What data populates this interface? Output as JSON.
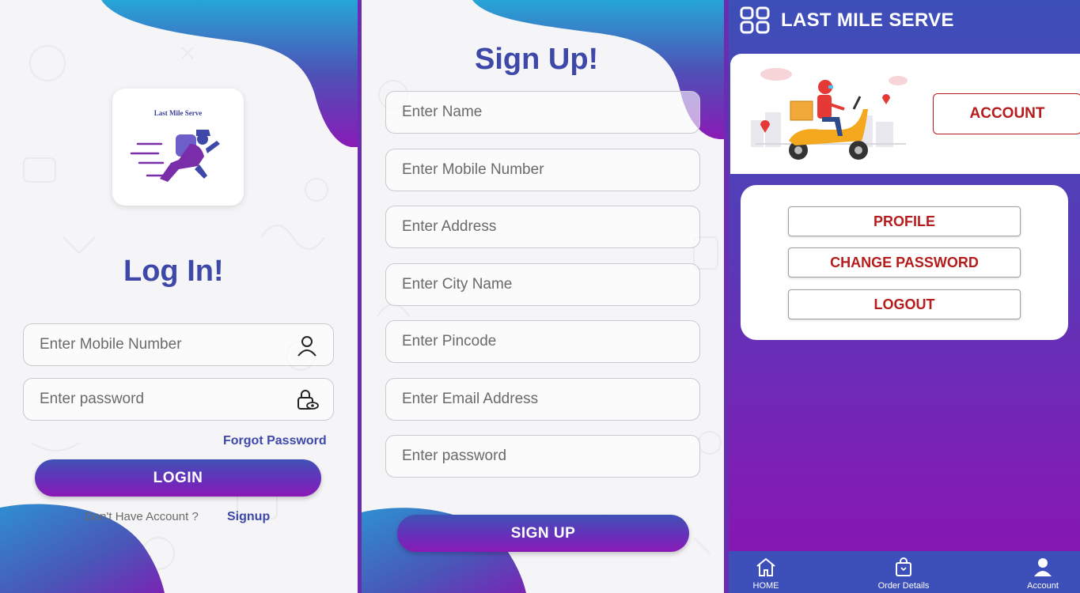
{
  "login": {
    "logo_text": "Last Mile Serve",
    "title": "Log In!",
    "mobile_placeholder": "Enter Mobile Number",
    "password_placeholder": "Enter password",
    "forgot_label": "Forgot Password",
    "login_label": "LOGIN",
    "no_account_text": "Don't Have Account ?",
    "signup_link": "Signup"
  },
  "signup": {
    "title": "Sign Up!",
    "fields": [
      {
        "placeholder": "Enter Name"
      },
      {
        "placeholder": "Enter Mobile Number"
      },
      {
        "placeholder": "Enter Address"
      },
      {
        "placeholder": "Enter City Name"
      },
      {
        "placeholder": "Enter Pincode"
      },
      {
        "placeholder": "Enter Email Address"
      },
      {
        "placeholder": "Enter password"
      }
    ],
    "signup_label": "SIGN UP"
  },
  "account": {
    "app_title": "LAST MILE SERVE",
    "banner_label": "ACCOUNT",
    "menu": [
      {
        "label": "PROFILE"
      },
      {
        "label": "CHANGE PASSWORD"
      },
      {
        "label": "LOGOUT"
      }
    ],
    "nav": [
      {
        "label": "HOME",
        "icon": "home-icon"
      },
      {
        "label": "Order Details",
        "icon": "shopping-bag-icon"
      },
      {
        "label": "Account",
        "icon": "user-icon"
      }
    ]
  },
  "colors": {
    "brand_blue": "#3d48a8",
    "gradient_start": "#3f51b5",
    "gradient_end": "#8a1ab6",
    "danger_red": "#b71c1c"
  }
}
